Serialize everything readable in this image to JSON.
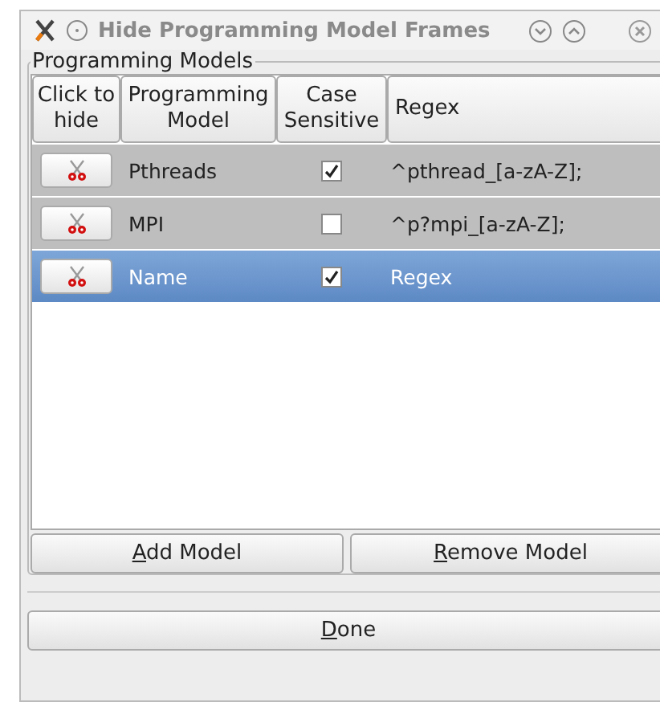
{
  "window": {
    "title": "Hide Programming Model Frames"
  },
  "group": {
    "title": "Programming Models"
  },
  "table": {
    "columns": [
      "Click to hide",
      "Programming Model",
      "Case Sensitive",
      "Regex"
    ],
    "rows": [
      {
        "model": "Pthreads",
        "case_sensitive": true,
        "regex": "^pthread_[a-zA-Z];",
        "selected": false
      },
      {
        "model": "MPI",
        "case_sensitive": false,
        "regex": "^p?mpi_[a-zA-Z];",
        "selected": false
      },
      {
        "model": "Name",
        "case_sensitive": true,
        "regex": "Regex",
        "selected": true
      }
    ]
  },
  "buttons": [
    "Add Model",
    "Remove Model"
  ],
  "done_button": "Done"
}
